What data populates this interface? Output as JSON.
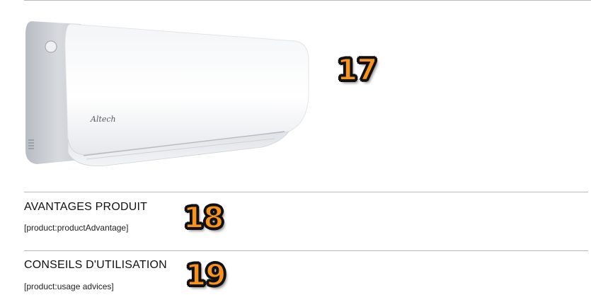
{
  "product_image": {
    "brand": "Altech"
  },
  "sections": {
    "advantages": {
      "title": "AVANTAGES PRODUIT",
      "placeholder": "[product:productAdvantage]"
    },
    "usage": {
      "title": "CONSEILS D'UTILISATION",
      "placeholder": "[product:usage advices]"
    }
  },
  "annotations": {
    "image_badge": "17",
    "advantages_badge": "18",
    "usage_badge": "19"
  },
  "colors": {
    "badge_fill": "#f7941d",
    "badge_outline": "#111111",
    "divider": "#b9b9b9"
  }
}
